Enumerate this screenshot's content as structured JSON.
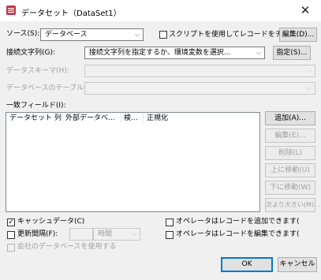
{
  "dialog": {
    "title": "データセット（DataSet1）"
  },
  "source": {
    "label": "ソース(S):",
    "value": "データベース"
  },
  "script_checkbox": {
    "label": "スクリプトを使用してレコードをチェッ",
    "checked": false
  },
  "edit_d_button": "編集(D)...",
  "connection": {
    "label": "接続文字列(G):",
    "value": "接続文字列を指定するか、環境変数を選択..."
  },
  "specify_button": "指定(S)...",
  "schema": {
    "label": "データスキーマ(H):"
  },
  "table": {
    "label": "データベースのテーブル(D)"
  },
  "fields": {
    "label": "一致フィールド(I):",
    "columns": [
      "データセット 列",
      "外部データベ...",
      "検...",
      "正規化"
    ]
  },
  "side_buttons": [
    "追加(A)...",
    "編集(E)...",
    "削除(L)",
    "上に移動(U)",
    "下に移動(W)",
    "次より大きい(M)..."
  ],
  "options": {
    "cache": {
      "label": "キャッシュデータ(C)",
      "checked": true
    },
    "refresh": {
      "label": "更新間隔(F):",
      "checked": false,
      "unit": "時間"
    },
    "company_db": {
      "label": "会社のデータベースを使用する",
      "checked": false
    },
    "operator_add": {
      "label": "オペレータはレコードを追加できます(",
      "checked": false
    },
    "operator_edit": {
      "label": "オペレータはレコードを編集できます(",
      "checked": false
    }
  },
  "footer": {
    "ok": "OK",
    "cancel": "キャンセル"
  },
  "colors": {
    "accent": "#0078d7",
    "icon": "#c4314b"
  }
}
